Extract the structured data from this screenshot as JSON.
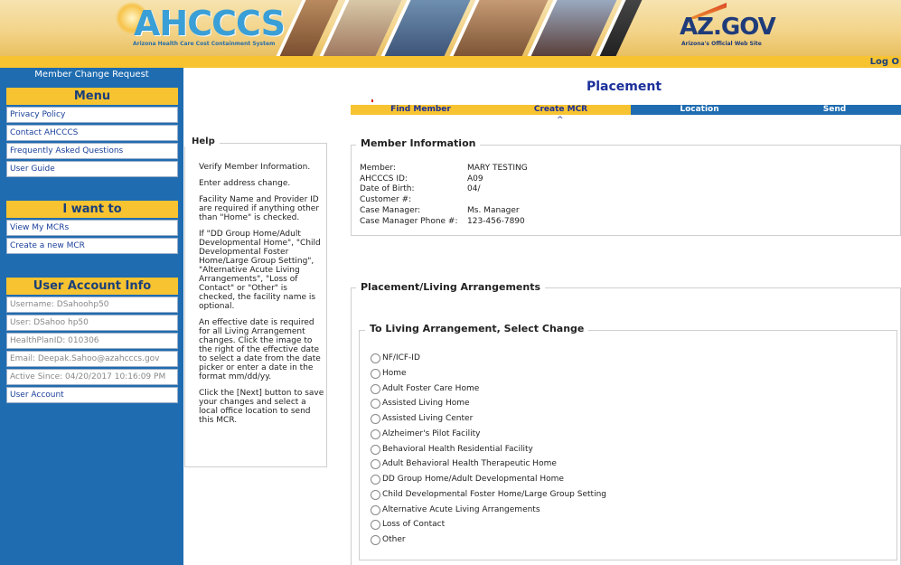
{
  "header": {
    "logo_text": "AHCCCS",
    "logo_subtitle": "Arizona Health Care Cost Containment System",
    "azgov_text": "AZ.GOV",
    "azgov_subtitle": "Arizona's Official Web Site",
    "logout_label": "Log O"
  },
  "sidebar": {
    "title": "Member Change Request",
    "menu_heading": "Menu",
    "menu_items": [
      "Privacy Policy",
      "Contact AHCCCS",
      "Frequently Asked Questions",
      "User Guide"
    ],
    "want_heading": "I want to",
    "want_items": [
      "View My MCRs",
      "Create a new MCR"
    ],
    "account_heading": "User Account Info",
    "account_items": [
      "Username: DSahoohp50",
      "User: DSahoo hp50",
      "HealthPlanID: 010306",
      "Email: Deepak.Sahoo@azahcccs.gov",
      "Active Since: 04/20/2017 10:16:09 PM"
    ],
    "account_link": "User Account"
  },
  "main": {
    "title": "Placement",
    "steps": [
      "Find Member",
      "Create MCR",
      "Location",
      "Send"
    ],
    "active_step_marker": "^"
  },
  "help": {
    "legend": "Help",
    "paragraphs": [
      "Verify Member Information.",
      "Enter address change.",
      "Facility Name and Provider ID are required if anything other than \"Home\" is checked.",
      "If \"DD Group Home/Adult Developmental Home\", \"Child Developmental Foster Home/Large Group Setting\", \"Alternative Acute Living Arrangements\", \"Loss of Contact\" or \"Other\" is checked, the facility name is optional.",
      "An effective date is required for all Living Arrangement changes. Click the image to the right of the effective date to select a date from the date picker or enter a date in the format mm/dd/yy.",
      "Click the [Next] button to save your changes and select a local office location to send this MCR."
    ]
  },
  "member_info": {
    "legend": "Member Information",
    "rows": [
      {
        "label": "Member:",
        "value": "MARY TESTING"
      },
      {
        "label": "AHCCCS ID:",
        "value": "A09"
      },
      {
        "label": "Date of Birth:",
        "value": "04/"
      },
      {
        "label": "Customer #:",
        "value": ""
      },
      {
        "label": "Case Manager:",
        "value": "Ms. Manager"
      },
      {
        "label": "Case Manager Phone #:",
        "value": "123-456-7890"
      }
    ]
  },
  "placement": {
    "legend": "Placement/Living Arrangements",
    "arrangement_legend": "To Living Arrangement, Select Change",
    "options": [
      "NF/ICF-ID",
      "Home",
      "Adult Foster Care Home",
      "Assisted Living Home",
      "Assisted Living Center",
      "Alzheimer's Pilot Facility",
      "Behavioral Health Residential Facility",
      "Adult Behavioral Health Therapeutic Home",
      "DD Group Home/Adult Developmental Home",
      "Child Developmental Foster Home/Large Group Setting",
      "Alternative Acute Living Arrangements",
      "Loss of Contact",
      "Other"
    ]
  },
  "colors": {
    "sidebar_blue": "#1f6cb0",
    "accent_yellow": "#f7c331",
    "title_blue": "#1a2f9a"
  }
}
